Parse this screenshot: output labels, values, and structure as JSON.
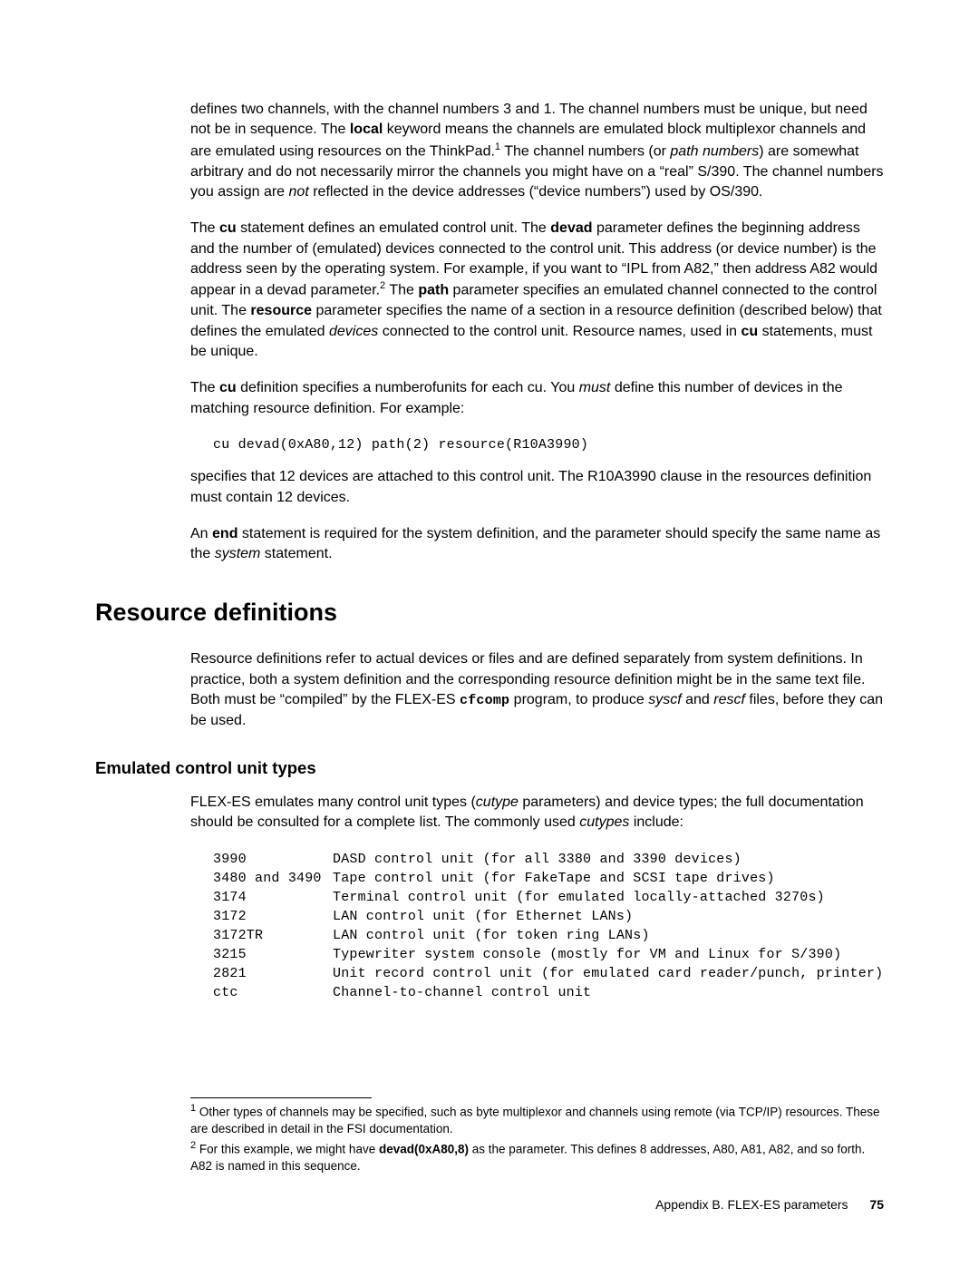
{
  "para1": {
    "t1": "defines two channels, with the channel numbers 3 and 1. The channel numbers must be unique, but need not be in sequence.  The ",
    "b1": "local",
    "t2": " keyword means the channels are emulated block multiplexor channels and are emulated using resources on the ThinkPad.",
    "sup1": "1",
    "t3": "  The channel numbers (or ",
    "i1": "path numbers",
    "t4": ") are somewhat arbitrary and do not necessarily mirror the channels you might have on a “real” S/390.  The channel numbers you assign are ",
    "i2": "not",
    "t5": " reflected in the device addresses (“device numbers”) used by OS/390."
  },
  "para2": {
    "t1": "The ",
    "b1": "cu",
    "t2": " statement defines an emulated control unit.  The ",
    "b2": "devad",
    "t3": " parameter defines the beginning address and the number of (emulated) devices connected to the control unit.  This address (or device number) is the address seen by the operating system.  For example, if you want to “IPL from A82,” then address A82 would appear in a devad parameter.",
    "sup1": "2",
    "t4": "  The ",
    "b3": "path",
    "t5": " parameter specifies an emulated channel connected to the control unit.  The ",
    "b4": "resource",
    "t6": " parameter specifies the name of a section in a resource definition (described below) that defines the emulated ",
    "i1": "devices",
    "t7": " connected to the control unit.  Resource names, used in ",
    "b5": "cu",
    "t8": " statements, must be unique."
  },
  "para3": {
    "t1": "The ",
    "b1": "cu",
    "t2": " definition specifies a numberofunits for each cu.  You ",
    "i1": "must",
    "t3": " define this number of devices in the matching resource definition. For example:"
  },
  "code1": "cu devad(0xA80,12) path(2) resource(R10A3990)",
  "para4": "specifies that 12 devices are attached to this control unit.  The R10A3990 clause in the resources definition must contain 12 devices.",
  "para5": {
    "t1": "An ",
    "b1": "end",
    "t2": " statement is required for the system definition, and the parameter should specify the same name as the ",
    "i1": "system",
    "t3": " statement."
  },
  "heading1": "Resource definitions",
  "para6": {
    "t1": "Resource definitions refer to actual devices or files and are defined separately from system definitions.  In practice, both a system definition and the corresponding resource definition might be in the same text file.  Both must be “compiled” by the FLEX-ES ",
    "m1": "cfcomp",
    "t2": " program, to produce ",
    "i1": "syscf",
    "t3": " and ",
    "i2": "rescf",
    "t4": " files, before they can be used."
  },
  "heading2": "Emulated control unit types",
  "para7": {
    "t1": "FLEX-ES emulates many control unit types (",
    "i1": "cutype",
    "t2": " parameters) and device types; the full documentation should be consulted for a complete list.  The commonly used ",
    "i2": "cutypes",
    "t3": " include:"
  },
  "cutypes": [
    {
      "name": "3990",
      "desc": "DASD control unit (for all 3380 and 3390 devices)"
    },
    {
      "name": "3480 and 3490",
      "desc": "Tape control unit (for FakeTape and SCSI tape drives)"
    },
    {
      "name": "3174",
      "desc": "Terminal control unit (for emulated locally-attached 3270s)"
    },
    {
      "name": "3172",
      "desc": "LAN control unit (for Ethernet LANs)"
    },
    {
      "name": "3172TR",
      "desc": "LAN control unit (for token ring LANs)"
    },
    {
      "name": "3215",
      "desc": "Typewriter system console (mostly for VM and Linux for S/390)"
    },
    {
      "name": "2821",
      "desc": "Unit record control unit (for emulated card reader/punch, printer)"
    },
    {
      "name": "ctc",
      "desc": "Channel-to-channel control unit"
    }
  ],
  "footnote1": {
    "sup": "1",
    "t": "  Other types of channels may be specified, such as byte multiplexor and channels using remote (via TCP/IP) resources.  These are described in detail in the FSI documentation."
  },
  "footnote2": {
    "sup": "2",
    "t1": "  For this example, we might have ",
    "b1": "devad(0xA80,8)",
    "t2": " as the parameter.  This defines 8 addresses, A80, A81, A82, and so forth.  A82 is named in this sequence."
  },
  "footer": {
    "text": "Appendix B. FLEX-ES parameters",
    "page": "75"
  }
}
